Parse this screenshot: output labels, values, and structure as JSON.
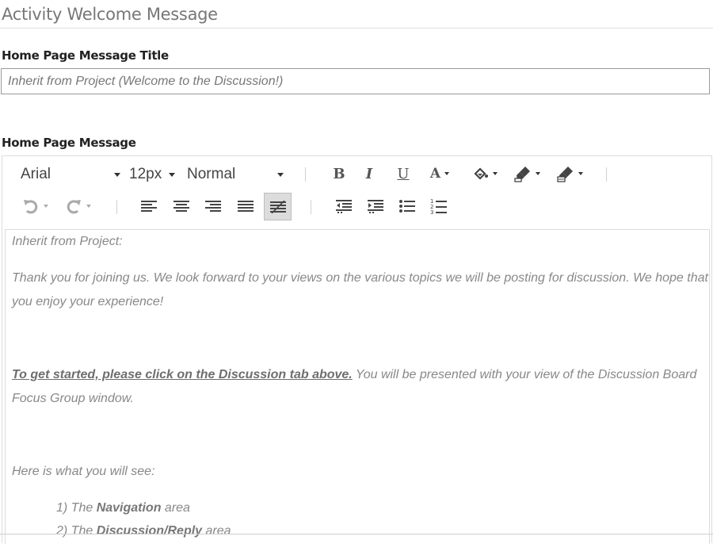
{
  "section": {
    "title": "Activity Welcome Message"
  },
  "title_field": {
    "label": "Home Page Message Title",
    "placeholder": "Inherit from Project (Welcome to the Discussion!)"
  },
  "message_field": {
    "label": "Home Page Message"
  },
  "toolbar": {
    "font_family": "Arial",
    "font_size": "12px",
    "block_format": "Normal",
    "bold_icon": "bold-icon",
    "italic_icon": "italic-icon",
    "underline_icon": "underline-icon",
    "text_color_icon": "text-color-icon",
    "highlight_icon": "highlight-icon",
    "format_painter_icon": "format-painter-icon",
    "active_alignment": "justify-none"
  },
  "content": {
    "line1": "Inherit from Project:",
    "para1": "Thank you for joining us. We look forward to your views on the various topics we will be posting for discussion. We hope that you enjoy your experience!",
    "link_text": "To get started, please click on the Discussion tab above.",
    "para2_rest": " You will be presented with your view of the Discussion Board Focus Group window.",
    "para3": "Here is what you will see:",
    "list": [
      {
        "prefix": "1) The ",
        "strong": "Navigation",
        "suffix": " area"
      },
      {
        "prefix": "2) The ",
        "strong": "Discussion/Reply",
        "suffix": " area"
      }
    ]
  }
}
